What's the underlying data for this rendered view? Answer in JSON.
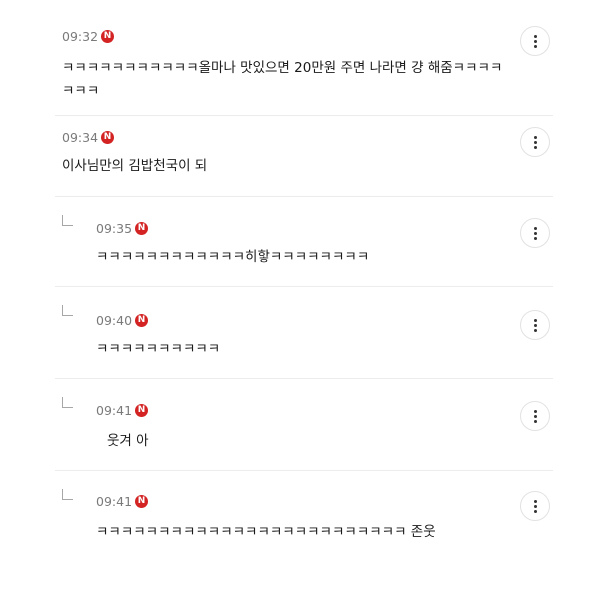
{
  "comments": [
    {
      "time": "09:32",
      "badge": "N",
      "text": "ㅋㅋㅋㅋㅋㅋㅋㅋㅋㅋㅋ올마나 맛있으면 20만원 주면 나라면 걍 해줌ㅋㅋㅋㅋㅋㅋㅋ",
      "is_reply": false
    },
    {
      "time": "09:34",
      "badge": "N",
      "text": "이사님만의 김밥천국이 되",
      "is_reply": false
    },
    {
      "time": "09:35",
      "badge": "N",
      "text": "ㅋㅋㅋㅋㅋㅋㅋㅋㅋㅋㅋㅋ히핳ㅋㅋㅋㅋㅋㅋㅋㅋ",
      "is_reply": true
    },
    {
      "time": "09:40",
      "badge": "N",
      "text": "ㅋㅋㅋㅋㅋㅋㅋㅋㅋㅋ",
      "is_reply": true
    },
    {
      "time": "09:41",
      "badge": "N",
      "text": "웃겨 아",
      "is_reply": true
    },
    {
      "time": "09:41",
      "badge": "N",
      "text": "ㅋㅋㅋㅋㅋㅋㅋㅋㅋㅋㅋㅋㅋㅋㅋㅋㅋㅋㅋㅋㅋㅋㅋㅋㅋ 존웃",
      "is_reply": true
    }
  ],
  "icons": {
    "more": "more-vertical-icon",
    "reply": "reply-arrow-icon",
    "new_badge": "new-badge-icon"
  },
  "colors": {
    "badge": "#d32323",
    "time": "#7a7a7a",
    "divider": "#ececec"
  }
}
